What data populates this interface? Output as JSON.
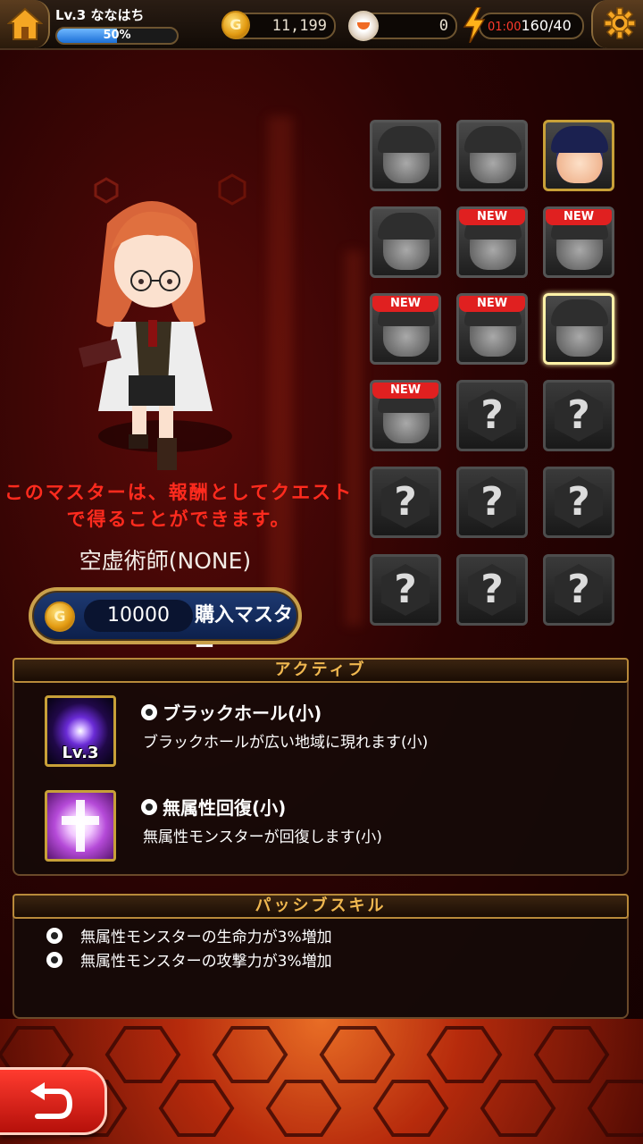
{
  "topbar": {
    "level_text": "Lv.3 ななはち",
    "exp_label": "50%",
    "exp_fraction": 0.5,
    "gold_coin_symbol": "G",
    "gold": "11,199",
    "gems": "0",
    "stamina_timer": "01:00",
    "stamina": "160/40"
  },
  "master": {
    "notice": "このマスターは、報酬としてクエストで得ることができます。",
    "name": "空虚術師(NONE)",
    "buy": {
      "coin_symbol": "G",
      "price": "10000",
      "label": "購入マスター"
    }
  },
  "grid": {
    "new_tag": "NEW",
    "locked_symbol": "?",
    "slots": [
      {
        "state": "silhouette",
        "new": false
      },
      {
        "state": "silhouette",
        "new": false
      },
      {
        "state": "owned",
        "new": false
      },
      {
        "state": "silhouette",
        "new": false
      },
      {
        "state": "silhouette",
        "new": true
      },
      {
        "state": "silhouette",
        "new": true
      },
      {
        "state": "silhouette",
        "new": true
      },
      {
        "state": "silhouette",
        "new": true
      },
      {
        "state": "selected",
        "new": false
      },
      {
        "state": "silhouette",
        "new": true
      },
      {
        "state": "locked",
        "new": false
      },
      {
        "state": "locked",
        "new": false
      },
      {
        "state": "locked",
        "new": false
      },
      {
        "state": "locked",
        "new": false
      },
      {
        "state": "locked",
        "new": false
      },
      {
        "state": "locked",
        "new": false
      },
      {
        "state": "locked",
        "new": false
      },
      {
        "state": "locked",
        "new": false
      }
    ]
  },
  "active": {
    "header": "アクティブ",
    "skills": [
      {
        "icon": "blackhole-icon",
        "level": "Lv.3",
        "name": "ブラックホール(小)",
        "desc": "ブラックホールが広い地域に現れます(小)"
      },
      {
        "icon": "holy-cross-icon",
        "level": "",
        "name": "無属性回復(小)",
        "desc": "無属性モンスターが回復します(小)"
      }
    ]
  },
  "passive": {
    "header": "パッシブスキル",
    "items": [
      "無属性モンスターの生命力が3%増加",
      "無属性モンスターの攻撃力が3%増加"
    ]
  },
  "colors": {
    "accent_gold": "#c8a038",
    "notice_red": "#ff2b1e",
    "new_red": "#e02020",
    "back_button": "#e8221a"
  }
}
